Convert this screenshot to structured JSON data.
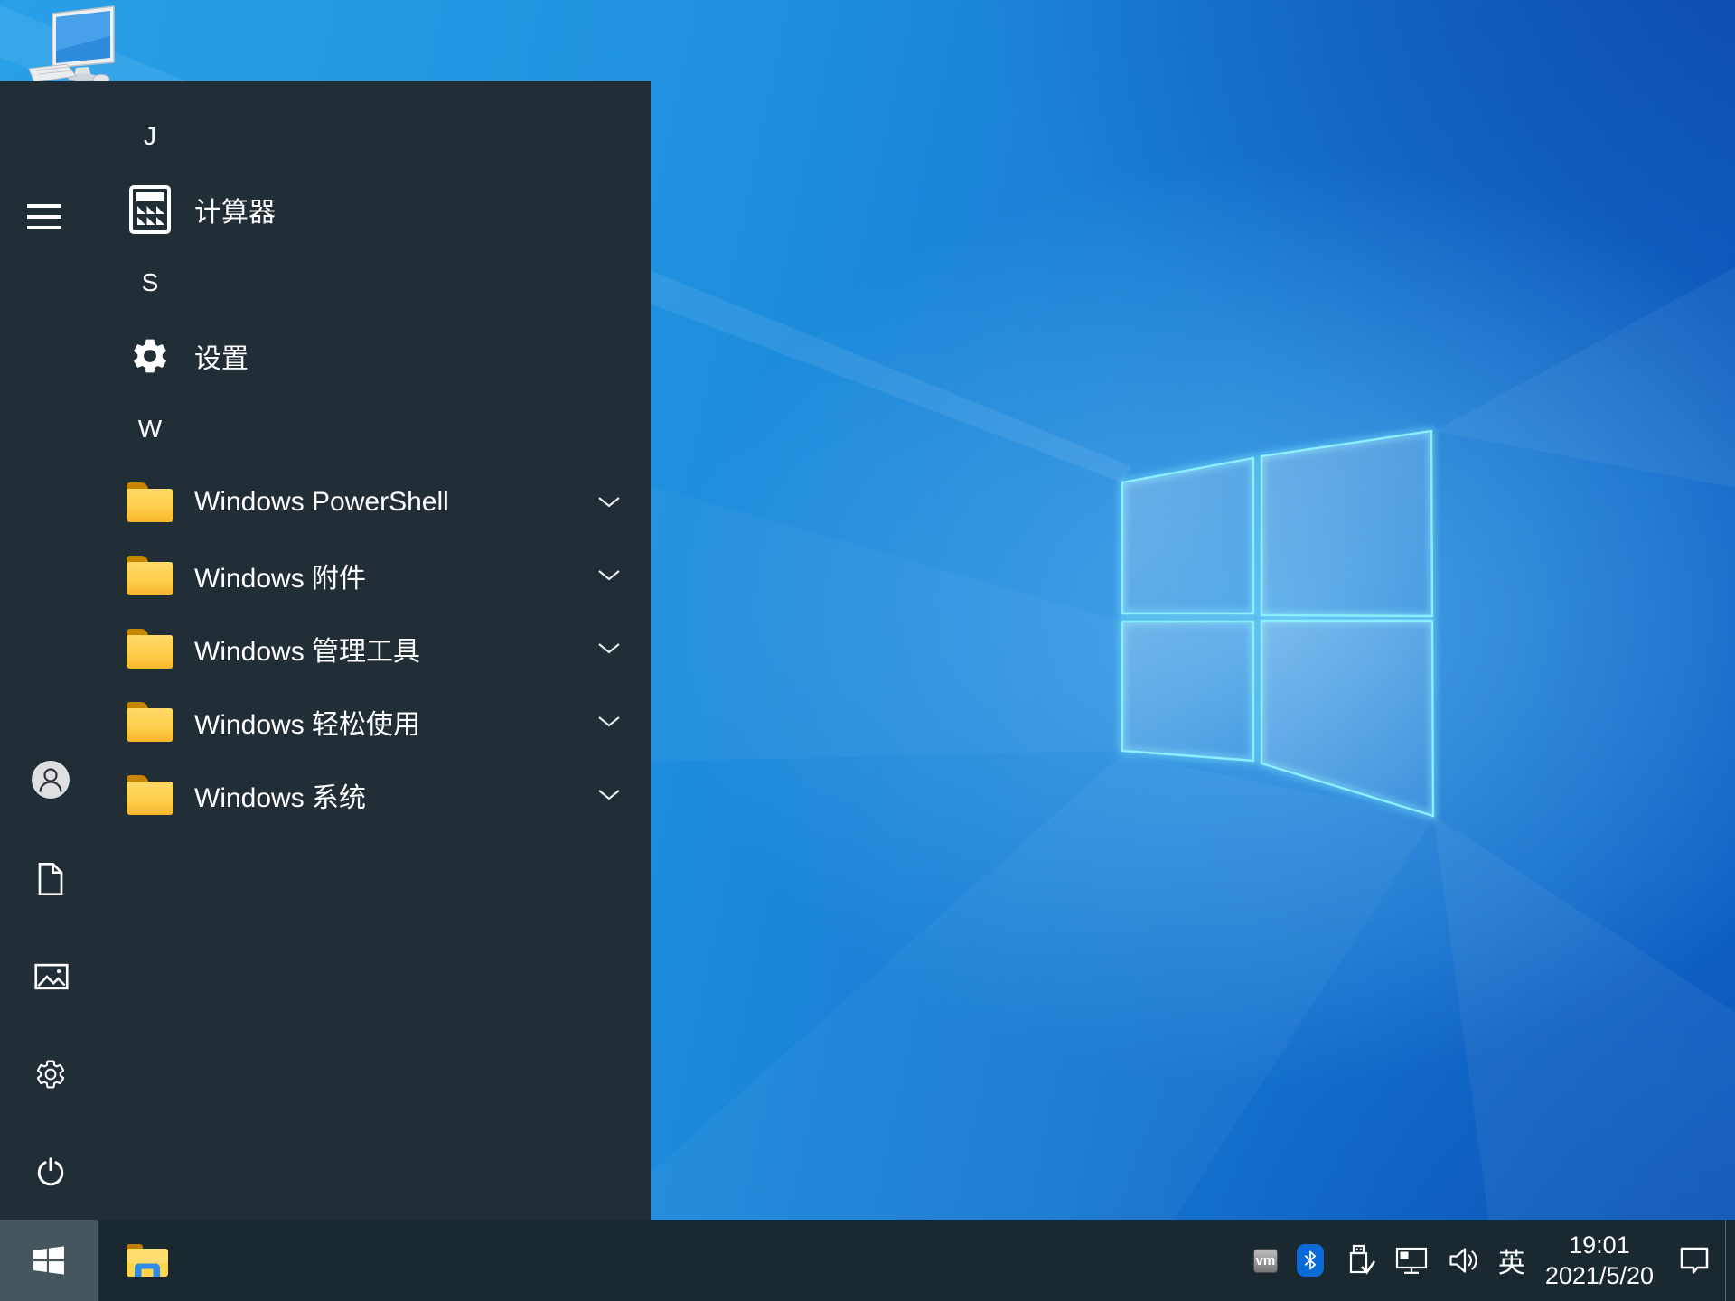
{
  "wallpaper": {
    "name": "windows-10-default-light-rays",
    "base_color": "#1e8fdd",
    "logo_edge_color": "#7fe9ff"
  },
  "desktop": {
    "icons": [
      {
        "name": "this-pc",
        "label_visible": false
      }
    ]
  },
  "start_menu": {
    "panel_color": "#212e36",
    "rows": [
      {
        "type": "section-header",
        "label": "J"
      },
      {
        "type": "app",
        "icon": "calculator-icon",
        "label": "计算器"
      },
      {
        "type": "section-header",
        "label": "S"
      },
      {
        "type": "app",
        "icon": "gear-icon",
        "label": "设置"
      },
      {
        "type": "section-header",
        "label": "W"
      },
      {
        "type": "folder",
        "icon": "folder-icon",
        "label": "Windows PowerShell",
        "chevron": "chevron-down"
      },
      {
        "type": "folder",
        "icon": "folder-icon",
        "label": "Windows 附件",
        "chevron": "chevron-down"
      },
      {
        "type": "folder",
        "icon": "folder-icon",
        "label": "Windows 管理工具",
        "chevron": "chevron-down"
      },
      {
        "type": "folder",
        "icon": "folder-icon",
        "label": "Windows 轻松使用",
        "chevron": "chevron-down"
      },
      {
        "type": "folder",
        "icon": "folder-icon",
        "label": "Windows 系统",
        "chevron": "chevron-down"
      }
    ],
    "rail": [
      {
        "name": "expand-menu"
      },
      {
        "name": "user-account"
      },
      {
        "name": "documents"
      },
      {
        "name": "pictures"
      },
      {
        "name": "settings"
      },
      {
        "name": "power"
      }
    ]
  },
  "taskbar": {
    "bar_color": "#1a2830",
    "start_button_active_color": "#46565f",
    "buttons": [
      {
        "name": "start"
      },
      {
        "name": "file-explorer"
      }
    ],
    "tray": {
      "vm_label": "vm",
      "icons": [
        "vmware-tools",
        "bluetooth",
        "usb-safely-remove",
        "network",
        "volume"
      ],
      "bluetooth_badge_color": "#0a6bd7",
      "ime_label": "英",
      "clock": {
        "time": "19:01",
        "date": "2021/5/20"
      }
    }
  }
}
